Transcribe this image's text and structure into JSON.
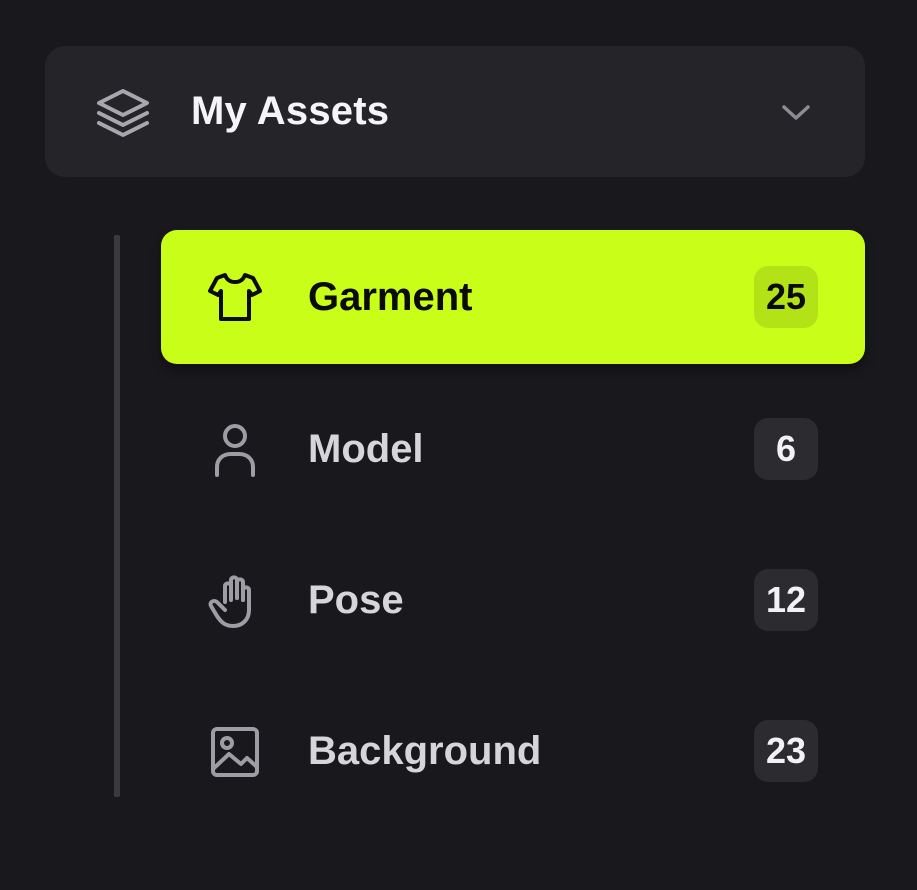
{
  "section": {
    "title": "My Assets",
    "icon": "layers-icon",
    "expanded": true
  },
  "colors": {
    "background": "#19191d",
    "header_bg": "#252529",
    "accent": "#c9fe19",
    "badge_bg": "#2c2c30"
  },
  "items": [
    {
      "label": "Garment",
      "count": "25",
      "icon": "shirt-icon",
      "active": true
    },
    {
      "label": "Model",
      "count": "6",
      "icon": "user-icon",
      "active": false
    },
    {
      "label": "Pose",
      "count": "12",
      "icon": "hand-icon",
      "active": false
    },
    {
      "label": "Background",
      "count": "23",
      "icon": "image-icon",
      "active": false
    }
  ]
}
